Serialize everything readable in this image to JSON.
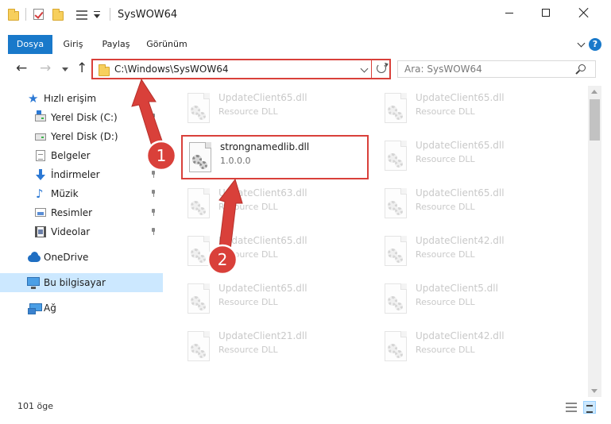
{
  "window": {
    "title": "SysWOW64",
    "controls": {
      "minimize": "minimize-icon",
      "maximize": "maximize-icon",
      "close": "close-icon"
    }
  },
  "ribbon": {
    "tabs": [
      {
        "label": "Dosya",
        "active": true
      },
      {
        "label": "Giriş"
      },
      {
        "label": "Paylaş"
      },
      {
        "label": "Görünüm"
      }
    ],
    "help": "?"
  },
  "address": {
    "path": "C:\\Windows\\SysWOW64",
    "search_placeholder": "Ara: SysWOW64"
  },
  "sidebar": {
    "items": [
      {
        "label": "Hızlı erişim",
        "icon": "star-icon"
      },
      {
        "label": "Yerel Disk (C:)",
        "icon": "drive-icon",
        "pinned": true
      },
      {
        "label": "Yerel Disk (D:)",
        "icon": "drive-icon",
        "pinned": true
      },
      {
        "label": "Belgeler",
        "icon": "documents-icon",
        "pinned": true
      },
      {
        "label": "İndirmeler",
        "icon": "download-icon",
        "pinned": true
      },
      {
        "label": "Müzik",
        "icon": "music-icon",
        "pinned": true
      },
      {
        "label": "Resimler",
        "icon": "pictures-icon",
        "pinned": true
      },
      {
        "label": "Videolar",
        "icon": "video-icon",
        "pinned": true
      },
      {
        "label": "OneDrive",
        "icon": "onedrive-icon"
      },
      {
        "label": "Bu bilgisayar",
        "icon": "computer-icon",
        "selected": true
      },
      {
        "label": "Ağ",
        "icon": "network-icon"
      }
    ]
  },
  "files": {
    "left": [
      {
        "name": "UpdateClient65.dll",
        "type": "Resource DLL"
      },
      {
        "name": "strongnamedlib.dll",
        "type": "1.0.0.0"
      },
      {
        "name": "UpdateClient63.dll",
        "type": "Resource DLL"
      },
      {
        "name": "UpdateClient65.dll",
        "type": "Resource DLL"
      },
      {
        "name": "UpdateClient65.dll",
        "type": "Resource DLL"
      },
      {
        "name": "UpdateClient21.dll",
        "type": "Resource DLL"
      }
    ],
    "right": [
      {
        "name": "UpdateClient65.dll",
        "type": "Resource DLL"
      },
      {
        "name": "UpdateClient65.dll",
        "type": "Resource DLL"
      },
      {
        "name": "UpdateClient65.dll",
        "type": "Resource DLL"
      },
      {
        "name": "UpdateClient42.dll",
        "type": "Resource DLL"
      },
      {
        "name": "UpdateClient5.dll",
        "type": "Resource DLL"
      },
      {
        "name": "UpdateClient42.dll",
        "type": "Resource DLL"
      }
    ]
  },
  "status": {
    "count": "101 öge"
  },
  "annotations": {
    "step1": "1",
    "step2": "2",
    "color": "#d9403a"
  }
}
